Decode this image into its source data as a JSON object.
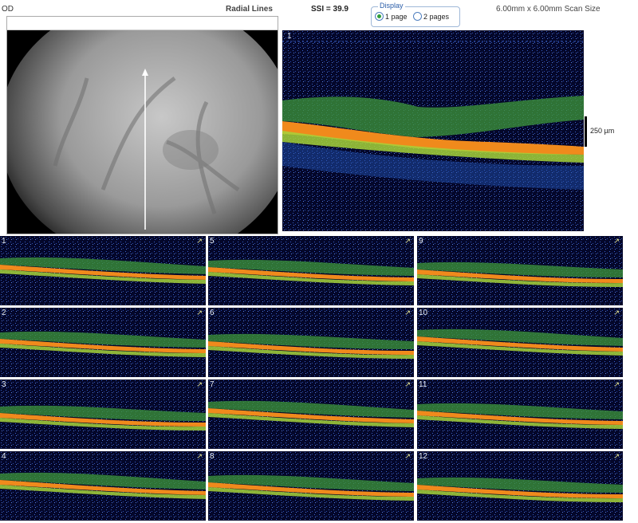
{
  "header": {
    "eye": "OD",
    "protocol": "Radial Lines",
    "ssi": "SSI = 39.9",
    "scan_size": "6.00mm x 6.00mm Scan Size"
  },
  "display": {
    "legend": "Display",
    "options": [
      {
        "label": "1 page",
        "selected": true
      },
      {
        "label": "2 pages",
        "selected": false
      }
    ]
  },
  "main_scan": {
    "number": "1",
    "scale_label": "250 µm"
  },
  "thumbnails": [
    {
      "number": "1"
    },
    {
      "number": "5"
    },
    {
      "number": "9"
    },
    {
      "number": "2"
    },
    {
      "number": "6"
    },
    {
      "number": "10"
    },
    {
      "number": "3"
    },
    {
      "number": "7"
    },
    {
      "number": "11"
    },
    {
      "number": "4"
    },
    {
      "number": "8"
    },
    {
      "number": "12"
    }
  ],
  "colors": {
    "scan_background": "#04072a",
    "retina_green": "#52c23a",
    "rpe_orange": "#f08a1c",
    "noise_blue": "#2b4fb7"
  }
}
